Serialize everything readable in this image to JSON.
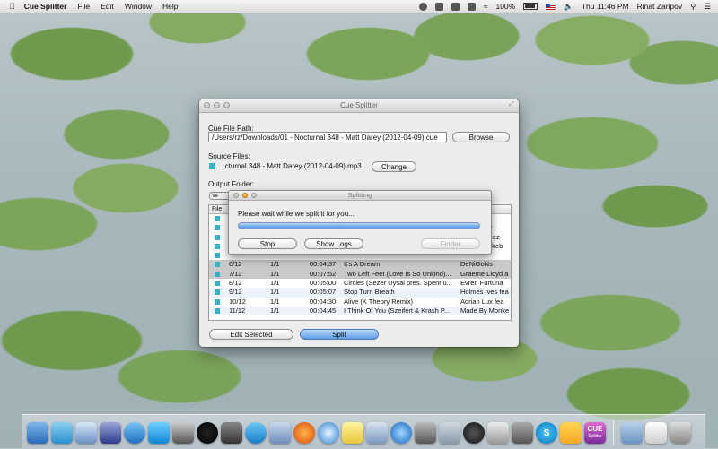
{
  "menubar": {
    "apple": "",
    "app_name": "Cue Splitter",
    "items": [
      "File",
      "Edit",
      "Window",
      "Help"
    ],
    "battery": "100%",
    "clock": "Thu 11:46 PM",
    "user": "Rinat Zaripov"
  },
  "window": {
    "title": "Cue Splitter",
    "cue_label": "Cue File Path:",
    "cue_path": "/Users/rz/Downloads/01 - Nocturnal 348 - Matt Darey (2012-04-09).cue",
    "browse_label": "Browse",
    "source_label": "Source Files:",
    "source_file": "...cturnal 348 - Matt Darey (2012-04-09).mp3",
    "change_label": "Change",
    "output_label": "Output Folder:",
    "output_tab": "Ve",
    "table_header": "File",
    "edit_selected_label": "Edit Selected",
    "split_label": "Split"
  },
  "tracks": [
    {
      "right": "l"
    },
    {
      "right": "sty"
    },
    {
      "right": "eleez"
    },
    {
      "right": "Bekeb"
    },
    {
      "right": ""
    },
    {
      "num": "6/12",
      "disc": "1/1",
      "time": "00:04:37",
      "title": "It's A Dream",
      "artist": "DeNiGoNs"
    },
    {
      "num": "7/12",
      "disc": "1/1",
      "time": "00:07:52",
      "title": "Two Left Feet (Love Is So Unkind)...",
      "artist": "Graeme Lloyd a"
    },
    {
      "num": "8/12",
      "disc": "1/1",
      "time": "00:05:00",
      "title": "Circles (Sezer Uysal pres. Spennu...",
      "artist": "Evren Furtuna"
    },
    {
      "num": "9/12",
      "disc": "1/1",
      "time": "00:05:07",
      "title": "Stop Turn Breath",
      "artist": "Holmes Ives fea"
    },
    {
      "num": "10/12",
      "disc": "1/1",
      "time": "00:04:30",
      "title": "Alive (K Theory Remix)",
      "artist": "Adrian Lux fea"
    },
    {
      "num": "11/12",
      "disc": "1/1",
      "time": "00:04:45",
      "title": "I Think Of You (Szeifert & Krash P...",
      "artist": "Made By Monke"
    }
  ],
  "splitting": {
    "title": "Splitting",
    "message": "Please wait while we split it for you...",
    "progress": 1.0,
    "stop_label": "Stop",
    "show_logs_label": "Show Logs",
    "finder_label": "Finder"
  },
  "dock": {
    "cue_icon_text": "CUE",
    "cue_icon_subtext": "Splitter"
  }
}
